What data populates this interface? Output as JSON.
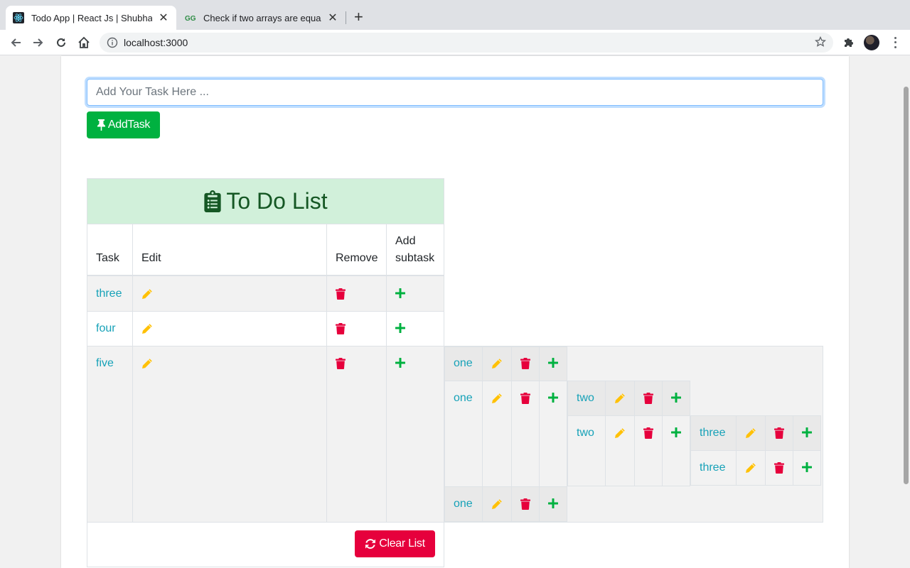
{
  "browser": {
    "tabs": [
      {
        "title": "Todo App | React Js | Shubham",
        "active": true
      },
      {
        "title": "Check if two arrays are equal or",
        "active": false
      }
    ],
    "url": "localhost:3000"
  },
  "form": {
    "placeholder": "Add Your Task Here ...",
    "value": "",
    "add_button": "AddTask"
  },
  "table": {
    "title": "To Do List",
    "headers": {
      "task": "Task",
      "edit": "Edit",
      "remove": "Remove",
      "add_line1": "Add",
      "add_line2": "subtask"
    },
    "rows": [
      "three",
      "four",
      "five"
    ],
    "subtasks": {
      "level1": [
        "one",
        "one",
        "one"
      ],
      "level2": [
        "two",
        "two"
      ],
      "level3": [
        "three",
        "three"
      ]
    },
    "clear_button": "Clear List"
  },
  "colors": {
    "task_text": "#17a2b8",
    "edit_icon": "#ffc107",
    "delete_icon": "#e6003c",
    "add_icon": "#00b140",
    "header_bg": "#d1f0da",
    "title_text": "#155724"
  },
  "icons": {
    "edit": "pencil-icon",
    "remove": "trash-icon",
    "add": "plus-icon",
    "title": "clipboard-list-icon",
    "add_task": "thumbtack-icon",
    "clear": "sync-icon"
  }
}
